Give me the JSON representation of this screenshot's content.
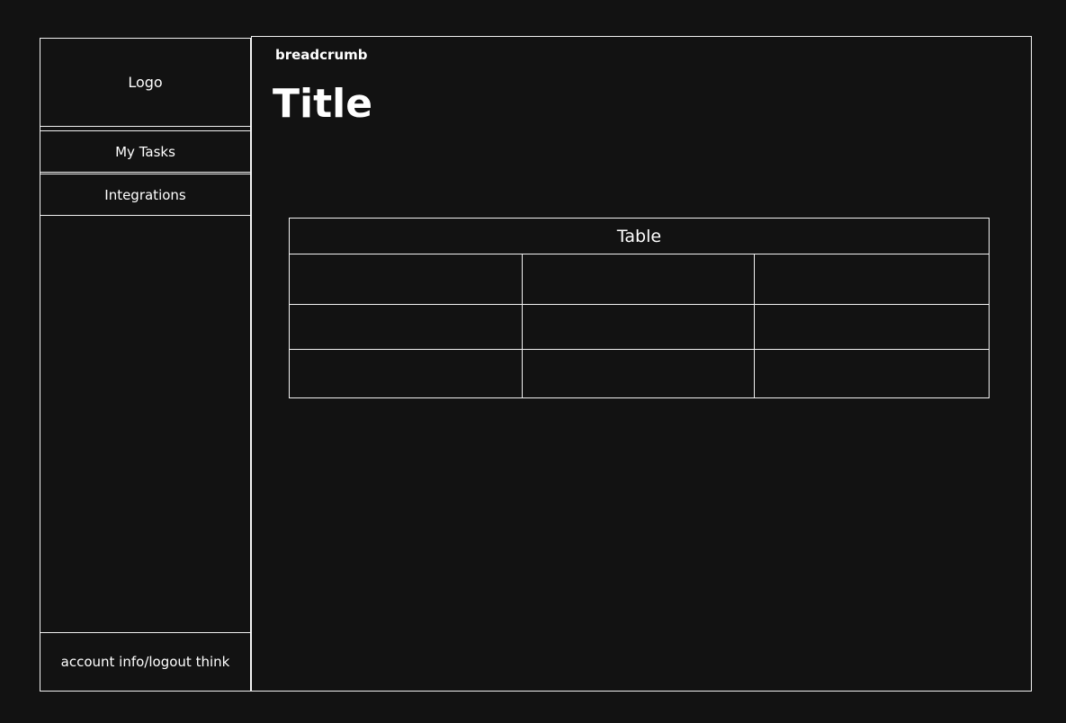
{
  "sidebar": {
    "logo": "Logo",
    "items": [
      {
        "label": "My Tasks"
      },
      {
        "label": "Integrations"
      }
    ],
    "account": "account info/logout think"
  },
  "main": {
    "breadcrumb": "breadcrumb",
    "title": "Title",
    "table": {
      "label": "Table",
      "rows": [
        [
          "",
          "",
          ""
        ],
        [
          "",
          "",
          ""
        ],
        [
          "",
          "",
          ""
        ]
      ]
    }
  },
  "colors": {
    "background": "#121212",
    "stroke": "#f2f2f2",
    "text": "#ffffff"
  }
}
